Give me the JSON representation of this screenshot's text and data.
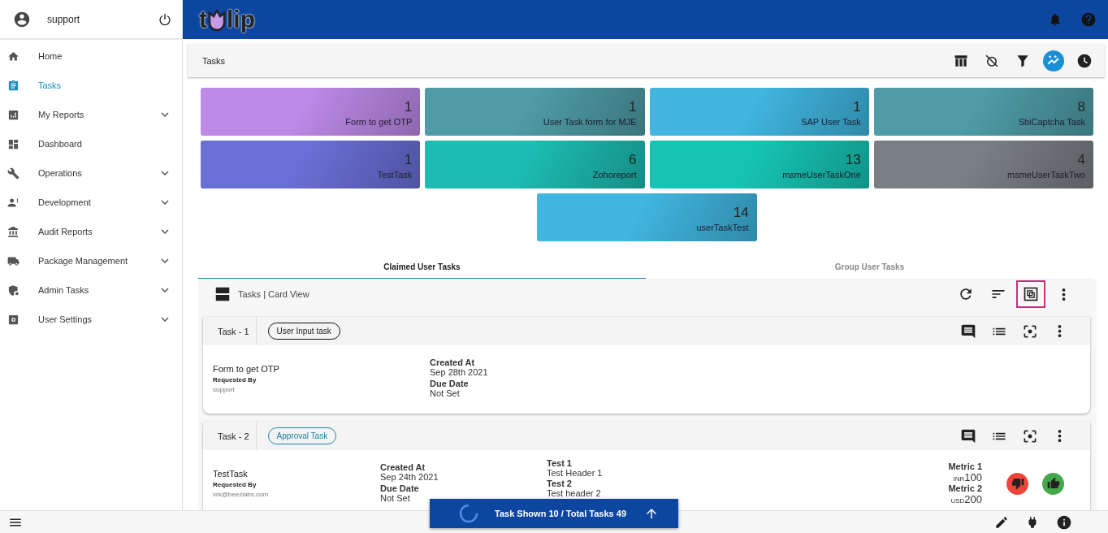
{
  "user": {
    "name": "support"
  },
  "nav": [
    {
      "label": "Home",
      "selected": false,
      "expandable": false
    },
    {
      "label": "Tasks",
      "selected": true,
      "expandable": false
    },
    {
      "label": "My Reports",
      "selected": false,
      "expandable": true
    },
    {
      "label": "Dashboard",
      "selected": false,
      "expandable": false
    },
    {
      "label": "Operations",
      "selected": false,
      "expandable": true
    },
    {
      "label": "Development",
      "selected": false,
      "expandable": true
    },
    {
      "label": "Audit Reports",
      "selected": false,
      "expandable": true
    },
    {
      "label": "Package Management",
      "selected": false,
      "expandable": true
    },
    {
      "label": "Admin Tasks",
      "selected": false,
      "expandable": true
    },
    {
      "label": "User Settings",
      "selected": false,
      "expandable": true
    }
  ],
  "logo": {
    "before": "t",
    "after": "lip"
  },
  "page_title": "Tasks",
  "toolbar_buttons": [
    {
      "selected": false
    },
    {
      "selected": false
    },
    {
      "selected": false
    },
    {
      "selected": true
    },
    {
      "selected": false
    }
  ],
  "tiles": [
    {
      "count": "1",
      "label": "Form to get OTP",
      "color": "#bd8ae8"
    },
    {
      "count": "1",
      "label": "User Task form for MJE",
      "color": "#4f9ca6"
    },
    {
      "count": "1",
      "label": "SAP User Task",
      "color": "#40b6e0"
    },
    {
      "count": "8",
      "label": "SbiCaptcha Task",
      "color": "#4f9ca6"
    },
    {
      "count": "1",
      "label": "TestTask",
      "color": "#6a6fd6"
    },
    {
      "count": "6",
      "label": "Zohoreport",
      "color": "#1cbcb2"
    },
    {
      "count": "13",
      "label": "msmeUserTaskOne",
      "color": "#16c4b4"
    },
    {
      "count": "4",
      "label": "msmeUserTaskTwo",
      "color": "#7a7f84"
    },
    {
      "count": "14",
      "label": "userTaskTest",
      "color": "#40b6e0"
    }
  ],
  "tabs": [
    {
      "label": "Claimed User Tasks",
      "selected": true
    },
    {
      "label": "Group User Tasks",
      "selected": false
    }
  ],
  "card_view": {
    "title": "Tasks | Card View",
    "tools": [
      {
        "highlighted": false
      },
      {
        "highlighted": false
      },
      {
        "highlighted": true
      },
      {
        "highlighted": false
      }
    ]
  },
  "tasks": [
    {
      "number": "Task - 1",
      "type": {
        "label": "User Input task",
        "kind": "input"
      },
      "name": "Form to get OTP",
      "requested_by_label": "Requested By",
      "requested_by": "support",
      "fields": [
        {
          "label": "Created At",
          "value": "Sep 28th 2021"
        },
        {
          "label": "Due Date",
          "value": "Not Set"
        }
      ]
    },
    {
      "number": "Task - 2",
      "type": {
        "label": "Approval Task",
        "kind": "approval"
      },
      "name": "TestTask",
      "requested_by_label": "Requested By",
      "requested_by": "vrk@beezlabs.com",
      "fields": [
        {
          "label": "Created At",
          "value": "Sep 24th 2021"
        },
        {
          "label": "Due Date",
          "value": "Not Set"
        }
      ],
      "tests": [
        {
          "label": "Test 1",
          "value": "Test Header 1"
        },
        {
          "label": "Test 2",
          "value": "Test header 2"
        }
      ],
      "metrics": [
        {
          "label": "Metric 1",
          "currency": "INR",
          "value": "100"
        },
        {
          "label": "Metric 2",
          "currency": "USD",
          "value": "200"
        }
      ],
      "approval_actions": true
    }
  ],
  "status": {
    "text": "Task Shown 10 / Total Tasks 49"
  }
}
